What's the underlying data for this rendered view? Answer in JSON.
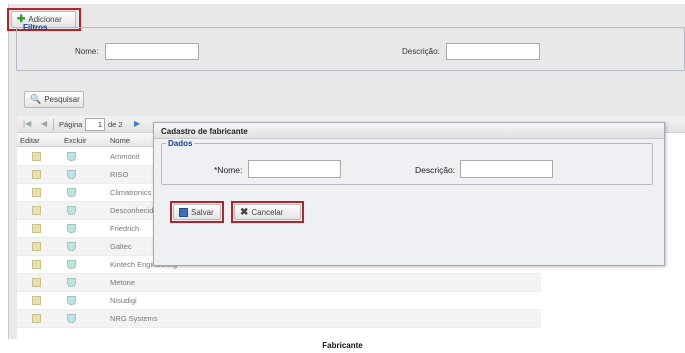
{
  "toolbar": {
    "add_label": "Adicionar"
  },
  "filters": {
    "legend": "Filtros",
    "name_label": "Nome:",
    "name_value": "",
    "description_label": "Descrição:",
    "description_value": "",
    "search_label": "Pesquisar"
  },
  "pager": {
    "page_label": "Página",
    "page_value": "1",
    "of_label": "de 2"
  },
  "grid": {
    "columns": [
      "Editar",
      "Excluir",
      "Nome"
    ],
    "rows": [
      {
        "name": "Ammonit"
      },
      {
        "name": "RISO"
      },
      {
        "name": "Climatronics"
      },
      {
        "name": "Desconhecid"
      },
      {
        "name": "Friedrich"
      },
      {
        "name": "Galtec"
      },
      {
        "name": "Kintech Engineering"
      },
      {
        "name": "Metone"
      },
      {
        "name": "Nisudigi"
      },
      {
        "name": "NRG Systems"
      }
    ]
  },
  "dialog": {
    "title": "Cadastro de fabricante",
    "section_legend": "Dados",
    "name_label": "*Nome:",
    "name_value": "",
    "description_label": "Descrição:",
    "description_value": "",
    "save_label": "Salvar",
    "cancel_label": "Cancelar"
  },
  "caption": "Fabricante",
  "colors": {
    "highlight": "#b2232b",
    "legend": "#15428b"
  }
}
